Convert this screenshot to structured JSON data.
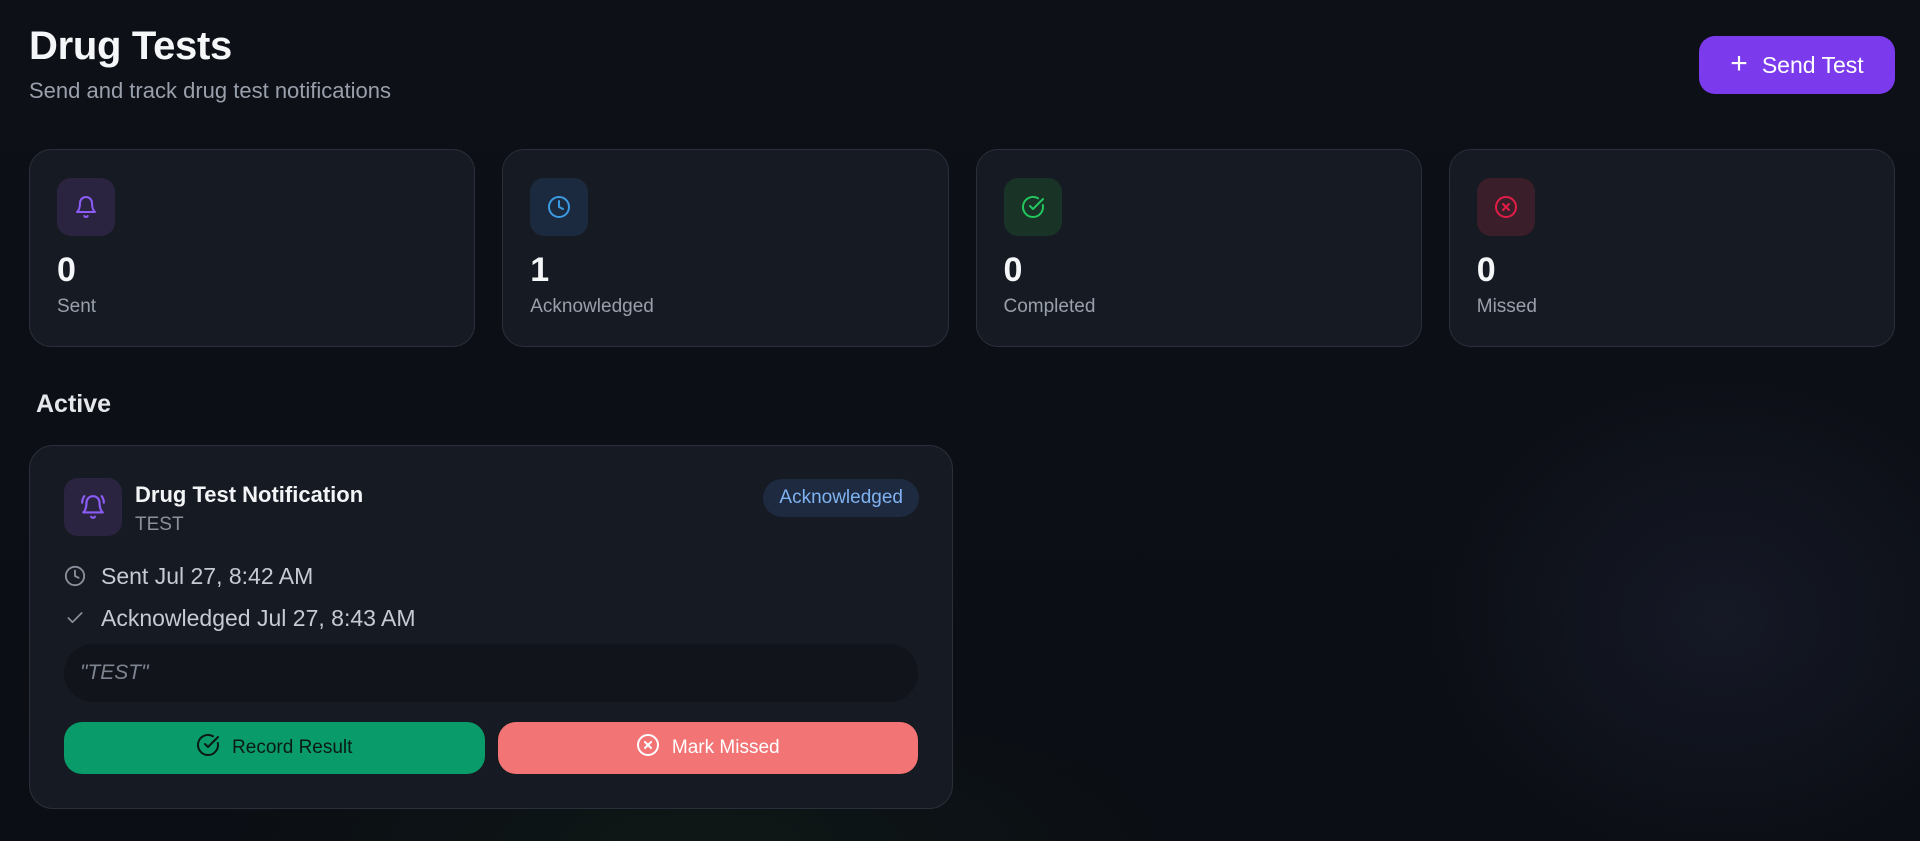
{
  "header": {
    "title": "Drug Tests",
    "subtitle": "Send and track drug test notifications",
    "send_button": "Send Test"
  },
  "stats": [
    {
      "value": "0",
      "label": "Sent",
      "icon": "bell-icon",
      "color": "#8b5cf6"
    },
    {
      "value": "1",
      "label": "Acknowledged",
      "icon": "clock-icon",
      "color": "#3b9ae1"
    },
    {
      "value": "0",
      "label": "Completed",
      "icon": "check-circle-icon",
      "color": "#22c55e"
    },
    {
      "value": "0",
      "label": "Missed",
      "icon": "x-circle-icon",
      "color": "#e11d48"
    }
  ],
  "active": {
    "section_title": "Active",
    "card": {
      "title": "Drug Test Notification",
      "subtitle": "TEST",
      "status": "Acknowledged",
      "sent": "Sent Jul 27, 8:42 AM",
      "acknowledged": "Acknowledged Jul 27, 8:43 AM",
      "note": "\"TEST\"",
      "record_button": "Record Result",
      "missed_button": "Mark Missed"
    }
  },
  "colors": {
    "accent": "#7c3aed",
    "success": "#0a9b6a",
    "danger": "#f27474",
    "badge_text": "#7fb2f0"
  }
}
